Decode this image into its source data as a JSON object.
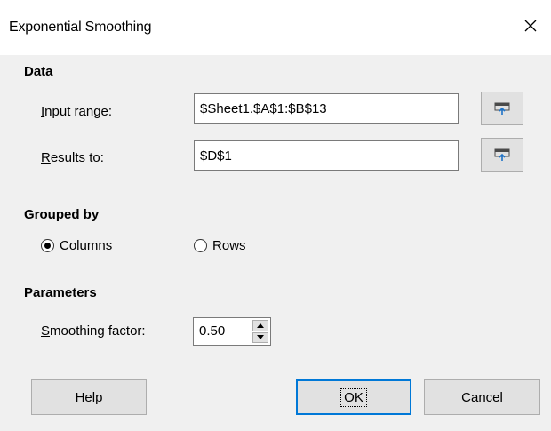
{
  "window": {
    "title": "Exponential Smoothing"
  },
  "data_section": {
    "heading": "Data",
    "input_range": {
      "label_mnemonic": "I",
      "label_rest": "nput range:",
      "value": "$Sheet1.$A$1:$B$13"
    },
    "results_to": {
      "label_mnemonic": "R",
      "label_rest": "esults to:",
      "value": "$D$1"
    }
  },
  "grouped_by": {
    "heading": "Grouped by",
    "columns": {
      "mnemonic": "C",
      "rest": "olumns",
      "selected": true
    },
    "rows": {
      "pre": "Ro",
      "mnemonic": "w",
      "rest": "s",
      "selected": false
    }
  },
  "parameters": {
    "heading": "Parameters",
    "smoothing": {
      "label_mnemonic": "S",
      "label_rest": "moothing factor:",
      "value": "0.50"
    }
  },
  "buttons": {
    "help": {
      "mnemonic": "H",
      "rest": "elp"
    },
    "ok": {
      "label": "OK"
    },
    "cancel": {
      "label": "Cancel"
    }
  },
  "colors": {
    "accent": "#0078d7",
    "background": "#f0f0f0"
  },
  "icons": {
    "close": "close-icon",
    "shrink": "shrink-dialog-icon"
  }
}
